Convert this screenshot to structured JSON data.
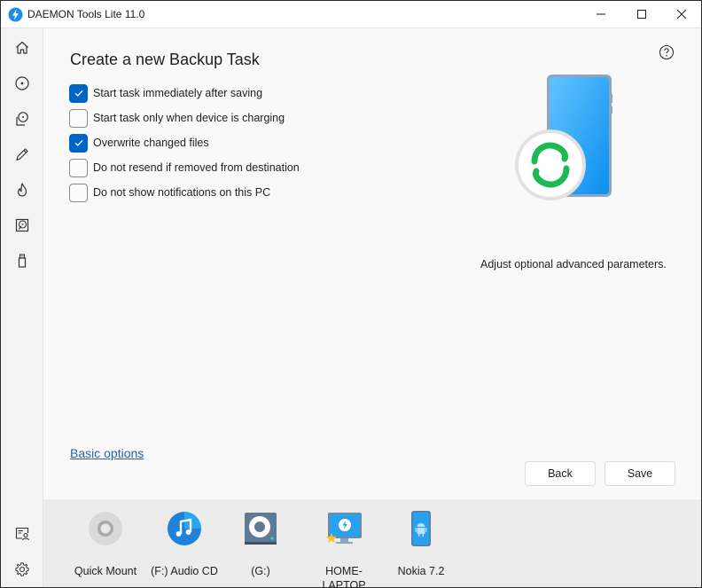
{
  "window": {
    "title": "DAEMON Tools Lite 11.0",
    "app_icon": "daemon-bolt-icon",
    "controls": [
      "minimize-icon",
      "maximize-icon",
      "close-icon"
    ]
  },
  "sidebar": {
    "items": [
      {
        "name": "home",
        "icon": "home-icon"
      },
      {
        "name": "images",
        "icon": "disc-icon"
      },
      {
        "name": "virtual-drives",
        "icon": "virtual-drive-icon"
      },
      {
        "name": "editor",
        "icon": "pencil-icon"
      },
      {
        "name": "burn",
        "icon": "flame-icon"
      },
      {
        "name": "hard-disk",
        "icon": "hdd-icon"
      },
      {
        "name": "usb",
        "icon": "usb-icon"
      }
    ],
    "bottom_items": [
      {
        "name": "license",
        "icon": "license-icon"
      },
      {
        "name": "settings",
        "icon": "gear-icon"
      }
    ]
  },
  "main": {
    "title": "Create a new Backup Task",
    "help_icon": "help-icon",
    "options": [
      {
        "label": "Start task immediately after saving",
        "checked": true
      },
      {
        "label": "Start task only when device is charging",
        "checked": false
      },
      {
        "label": "Overwrite changed files",
        "checked": true
      },
      {
        "label": "Do not resend if removed from destination",
        "checked": false
      },
      {
        "label": "Do not show notifications on this PC",
        "checked": false
      }
    ],
    "hint": "Adjust optional advanced parameters.",
    "basic_link": "Basic options",
    "back_label": "Back",
    "save_label": "Save",
    "colors": {
      "accent": "#0063c6",
      "link": "#2b5fa8",
      "sync_green": "#1db954"
    }
  },
  "tray": {
    "devices": [
      {
        "label": "Quick Mount",
        "icon": "quick-mount-icon"
      },
      {
        "label": "(F:) Audio CD",
        "icon": "audio-cd-icon"
      },
      {
        "label": "(G:)",
        "icon": "virtual-drive-icon"
      },
      {
        "label": "HOME-LAPTOP",
        "icon": "computer-icon"
      },
      {
        "label": "Nokia 7.2",
        "icon": "android-phone-icon"
      }
    ]
  }
}
